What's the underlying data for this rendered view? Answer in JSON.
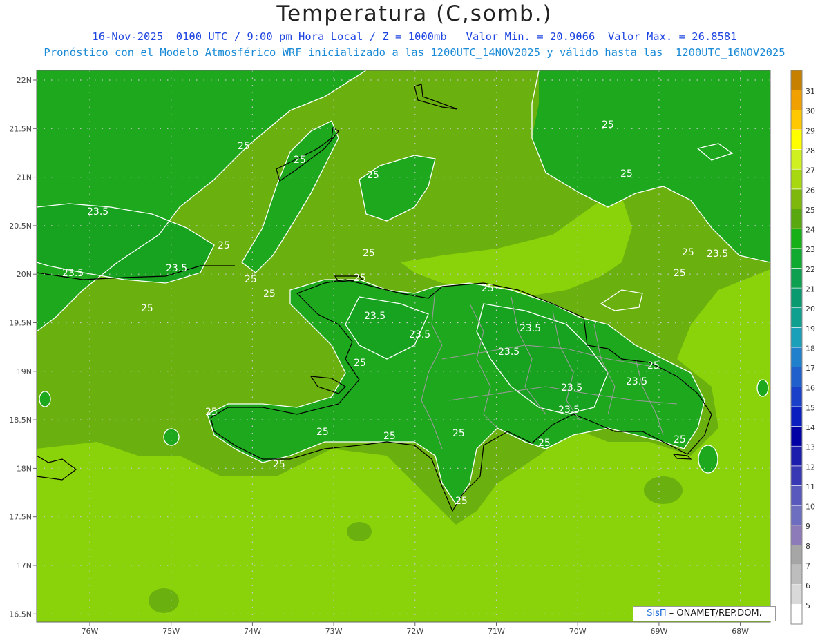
{
  "title": "Temperatura (C,somb.)",
  "subtitle_line1": "16-Nov-2025  0100 UTC / 9:00 pm Hora Local / Z = 1000mb   Valor Min. = 20.9066  Valor Max. = 26.8581",
  "subtitle_line2": "Pronóstico con el Modelo Atmosférico WRF inicializado a las 1200UTC_14NOV2025 y válido hasta las  1200UTC_16NOV2025",
  "credit_brand": "SisΠ",
  "credit_text": " – ONAMET/REP.DOM.",
  "lat_labels": [
    "22N",
    "21.5N",
    "21N",
    "20.5N",
    "20N",
    "19.5N",
    "19N",
    "18.5N",
    "18N",
    "17.5N",
    "17N",
    "16.5N"
  ],
  "lon_labels": [
    "76W",
    "75W",
    "74W",
    "73W",
    "72W",
    "71W",
    "70W",
    "69W",
    "68W"
  ],
  "colorbar": {
    "levels": [
      "5",
      "6",
      "7",
      "8",
      "9",
      "10",
      "11",
      "12",
      "13",
      "14",
      "15",
      "16",
      "17",
      "18",
      "19",
      "20",
      "21",
      "22",
      "23",
      "24",
      "25",
      "26",
      "27",
      "28",
      "29",
      "30",
      "31"
    ],
    "colors": [
      "#ffffff",
      "#d9d9d9",
      "#bdbdbd",
      "#a6a6a6",
      "#8c7bb8",
      "#6e6ec0",
      "#5858bd",
      "#3838b5",
      "#1c1cad",
      "#0000a5",
      "#0a1ec0",
      "#1a3fc8",
      "#2060cc",
      "#2080cc",
      "#1aa0b8",
      "#10a090",
      "#0a9a70",
      "#0ca050",
      "#10aa30",
      "#18b018",
      "#5aa810",
      "#7fb80c",
      "#a8d810",
      "#d0f020",
      "#ffff00",
      "#ffc800",
      "#f0a000",
      "#c88000"
    ]
  },
  "contour_labels": [
    "25",
    "23.5"
  ],
  "field_colors": {
    "t23": "#18a81e",
    "t24": "#1da81e",
    "t25": "#5fa80e",
    "t26": "#8ad30a",
    "dark": "#2c9a4a"
  }
}
